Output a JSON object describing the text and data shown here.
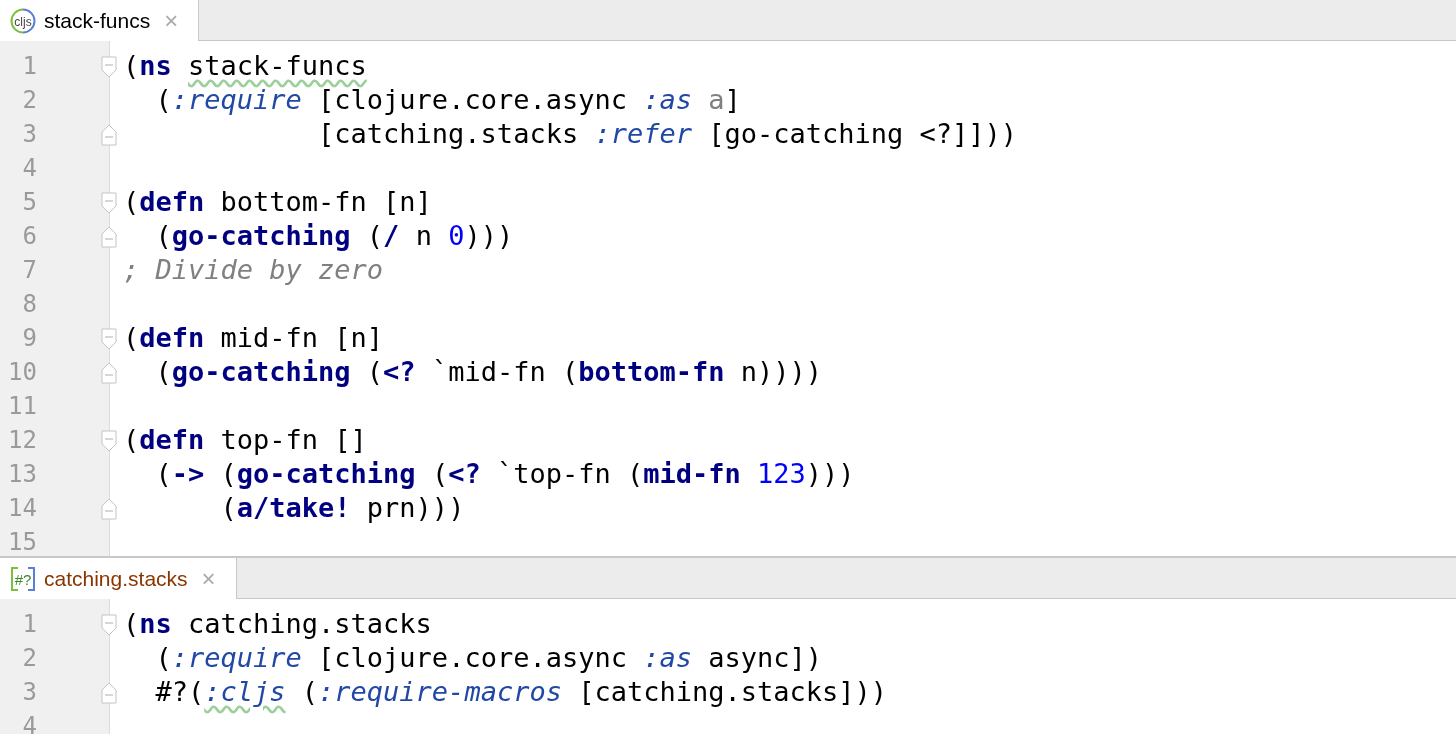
{
  "editors": [
    {
      "tab": {
        "icon": {
          "kind": "circle",
          "text": "cljs"
        },
        "label": "stack-funcs",
        "color": "#000000",
        "close": "×"
      },
      "lines": [
        {
          "number": "1",
          "fold_start": true,
          "fold_end": false,
          "tokens": [
            {
              "text": "(",
              "kind": "plain"
            },
            {
              "text": "ns ",
              "kind": "keyword"
            },
            {
              "text": "stack-funcs",
              "kind": "plain-warned"
            }
          ]
        },
        {
          "number": "2",
          "fold_start": false,
          "fold_end": false,
          "tokens": [
            {
              "text": "  (",
              "kind": "plain"
            },
            {
              "text": ":require",
              "kind": "keyword-arg"
            },
            {
              "text": " [clojure.core.async ",
              "kind": "plain"
            },
            {
              "text": ":as ",
              "kind": "keyword-arg"
            },
            {
              "text": "a",
              "kind": "unused"
            },
            {
              "text": "]",
              "kind": "plain"
            }
          ]
        },
        {
          "number": "3",
          "fold_start": false,
          "fold_end": true,
          "tokens": [
            {
              "text": "            [catching.stacks ",
              "kind": "plain"
            },
            {
              "text": ":refer",
              "kind": "keyword-arg"
            },
            {
              "text": " [go-catching <?]]))",
              "kind": "plain"
            }
          ]
        },
        {
          "number": "4",
          "fold_start": false,
          "fold_end": false
        },
        {
          "number": "5",
          "fold_start": true,
          "fold_end": false,
          "tokens": [
            {
              "text": "(",
              "kind": "plain"
            },
            {
              "text": "defn",
              "kind": "keyword"
            },
            {
              "text": " bottom-fn [n]",
              "kind": "plain"
            }
          ]
        },
        {
          "number": "6",
          "fold_start": false,
          "fold_end": true,
          "tokens": [
            {
              "text": "  (",
              "kind": "plain"
            },
            {
              "text": "go-catching",
              "kind": "keyword"
            },
            {
              "text": " (",
              "kind": "plain"
            },
            {
              "text": "/",
              "kind": "keyword"
            },
            {
              "text": " n ",
              "kind": "plain"
            },
            {
              "text": "0",
              "kind": "number"
            },
            {
              "text": ")))",
              "kind": "plain"
            }
          ]
        },
        {
          "number": "7",
          "fold_start": false,
          "fold_end": false,
          "tokens": [
            {
              "text": "; Divide by zero",
              "kind": "comment"
            }
          ]
        },
        {
          "number": "8",
          "fold_start": false,
          "fold_end": false
        },
        {
          "number": "9",
          "fold_start": true,
          "fold_end": false,
          "tokens": [
            {
              "text": "(",
              "kind": "plain"
            },
            {
              "text": "defn",
              "kind": "keyword"
            },
            {
              "text": " mid-fn [n]",
              "kind": "plain"
            }
          ]
        },
        {
          "number": "10",
          "fold_start": false,
          "fold_end": true,
          "tokens": [
            {
              "text": "  (",
              "kind": "plain"
            },
            {
              "text": "go-catching",
              "kind": "keyword"
            },
            {
              "text": " (",
              "kind": "plain"
            },
            {
              "text": "<?",
              "kind": "keyword"
            },
            {
              "text": " `mid-fn (",
              "kind": "plain"
            },
            {
              "text": "bottom-fn",
              "kind": "keyword"
            },
            {
              "text": " n))))",
              "kind": "plain"
            }
          ]
        },
        {
          "number": "11",
          "fold_start": false,
          "fold_end": false
        },
        {
          "number": "12",
          "fold_start": true,
          "fold_end": false,
          "tokens": [
            {
              "text": "(",
              "kind": "plain"
            },
            {
              "text": "defn",
              "kind": "keyword"
            },
            {
              "text": " top-fn []",
              "kind": "plain"
            }
          ]
        },
        {
          "number": "13",
          "fold_start": false,
          "fold_end": false,
          "tokens": [
            {
              "text": "  (",
              "kind": "plain"
            },
            {
              "text": "->",
              "kind": "keyword"
            },
            {
              "text": " (",
              "kind": "plain"
            },
            {
              "text": "go-catching",
              "kind": "keyword"
            },
            {
              "text": " (",
              "kind": "plain"
            },
            {
              "text": "<?",
              "kind": "keyword"
            },
            {
              "text": " `top-fn (",
              "kind": "plain"
            },
            {
              "text": "mid-fn ",
              "kind": "keyword"
            },
            {
              "text": "123",
              "kind": "number"
            },
            {
              "text": ")))",
              "kind": "plain"
            }
          ]
        },
        {
          "number": "14",
          "fold_start": false,
          "fold_end": true,
          "tokens": [
            {
              "text": "      (",
              "kind": "plain"
            },
            {
              "text": "a/take!",
              "kind": "keyword"
            },
            {
              "text": " prn)))",
              "kind": "plain"
            }
          ]
        },
        {
          "number": "15",
          "fold_start": false,
          "fold_end": false
        }
      ]
    },
    {
      "tab": {
        "icon": {
          "kind": "bracket",
          "text": "#?"
        },
        "label": "catching.stacks",
        "color": "#8a3500",
        "close": "×"
      },
      "lines": [
        {
          "number": "1",
          "fold_start": true,
          "fold_end": false,
          "tokens": [
            {
              "text": "(",
              "kind": "plain"
            },
            {
              "text": "ns",
              "kind": "keyword"
            },
            {
              "text": " catching.stacks",
              "kind": "plain"
            }
          ]
        },
        {
          "number": "2",
          "fold_start": false,
          "fold_end": false,
          "tokens": [
            {
              "text": "  (",
              "kind": "plain"
            },
            {
              "text": ":require",
              "kind": "keyword-arg"
            },
            {
              "text": " [clojure.core.async ",
              "kind": "plain"
            },
            {
              "text": ":as",
              "kind": "keyword-arg"
            },
            {
              "text": " async])",
              "kind": "plain"
            }
          ]
        },
        {
          "number": "3",
          "fold_start": false,
          "fold_end": true,
          "tokens": [
            {
              "text": "  #?(",
              "kind": "plain"
            },
            {
              "text": ":cljs",
              "kind": "keyword-arg-warned"
            },
            {
              "text": " (",
              "kind": "plain"
            },
            {
              "text": ":require-macros",
              "kind": "keyword-arg"
            },
            {
              "text": " [catching.stacks]))",
              "kind": "plain"
            }
          ]
        },
        {
          "number": "4",
          "fold_start": false,
          "fold_end": false
        }
      ]
    }
  ]
}
